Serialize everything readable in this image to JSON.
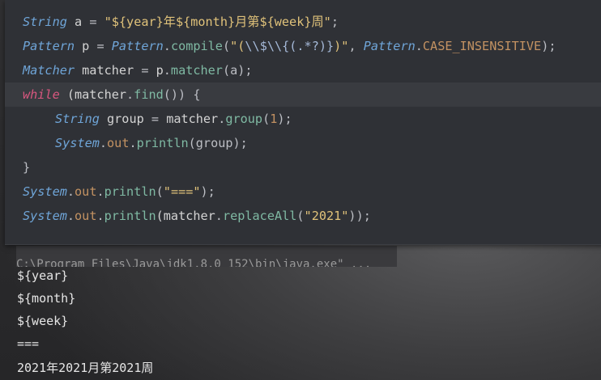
{
  "code": {
    "l1": {
      "k": "String",
      "v": " a ",
      "eq": "=",
      "s1": "\"${year}年${month}月第${week}周\"",
      "end": ";"
    },
    "l2": {
      "k": "Pattern",
      "v": " p ",
      "eq": "=",
      "c": "Pattern",
      "dot": ".",
      "fn": "compile",
      "op": "(",
      "s1": "\"(",
      "rx": "\\\\$\\\\{(.*?)}",
      "s2": ")\"",
      "cm": ", ",
      "c2": "Pattern",
      "dot2": ".",
      "f": "CASE_INSENSITIVE",
      "end": ");"
    },
    "l3": {
      "k": "Matcher",
      "v": " matcher ",
      "eq": "=",
      "r": " p",
      "dot": ".",
      "fn": "matcher",
      "args": "(a);"
    },
    "l4": {
      "kw": "while",
      "a": " (matcher",
      "dot": ".",
      "fn": "find",
      "b": "()) {"
    },
    "l5": {
      "k": "String",
      "v": " group ",
      "eq": "=",
      "r": " matcher",
      "dot": ".",
      "fn": "group",
      "op": "(",
      "n": "1",
      "end": ");"
    },
    "l6": {
      "k": "System",
      "dot": ".",
      "f": "out",
      "dot2": ".",
      "fn": "println",
      "args": "(group);"
    },
    "l7": {
      "b": "}"
    },
    "l8": {
      "k": "System",
      "dot": ".",
      "f": "out",
      "dot2": ".",
      "fn": "println",
      "op": "(",
      "s": "\"===\"",
      "end": ");"
    },
    "l9": {
      "k": "System",
      "dot": ".",
      "f": "out",
      "dot2": ".",
      "fn": "println",
      "op": "(matcher",
      "dot3": ".",
      "fn2": "replaceAll",
      "op2": "(",
      "s": "\"2021\"",
      "end": "));"
    }
  },
  "console": {
    "cut_line": "C:\\Program Files\\Java\\jdk1.8.0_152\\bin\\java.exe\" ...",
    "output": [
      "${year}",
      "${month}",
      "${week}",
      "===",
      "2021年2021月第2021周"
    ]
  }
}
